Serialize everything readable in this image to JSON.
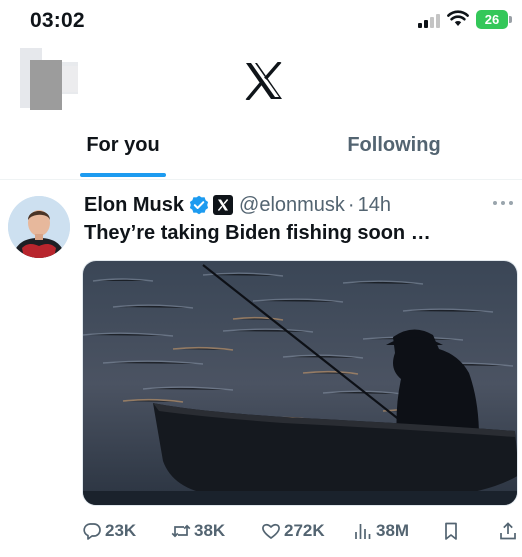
{
  "status_bar": {
    "time": "03:02",
    "battery_level": "26",
    "signal_bars": 2
  },
  "header": {
    "logo": "x-logo-icon"
  },
  "tabs": [
    {
      "label": "For you",
      "active": true
    },
    {
      "label": "Following",
      "active": false
    }
  ],
  "tweet": {
    "author_name": "Elon Musk",
    "handle": "@elonmusk",
    "separator": "·",
    "timestamp": "14h",
    "text": "They’re taking Biden fishing soon …",
    "media_icon": "image-fisherman-in-boat",
    "actions": {
      "replies": "23K",
      "reposts": "38K",
      "likes": "272K",
      "views": "38M"
    }
  },
  "colors": {
    "accent": "#1d9bf0",
    "text": "#0f1419",
    "muted": "#536471",
    "battery": "#34c759"
  }
}
